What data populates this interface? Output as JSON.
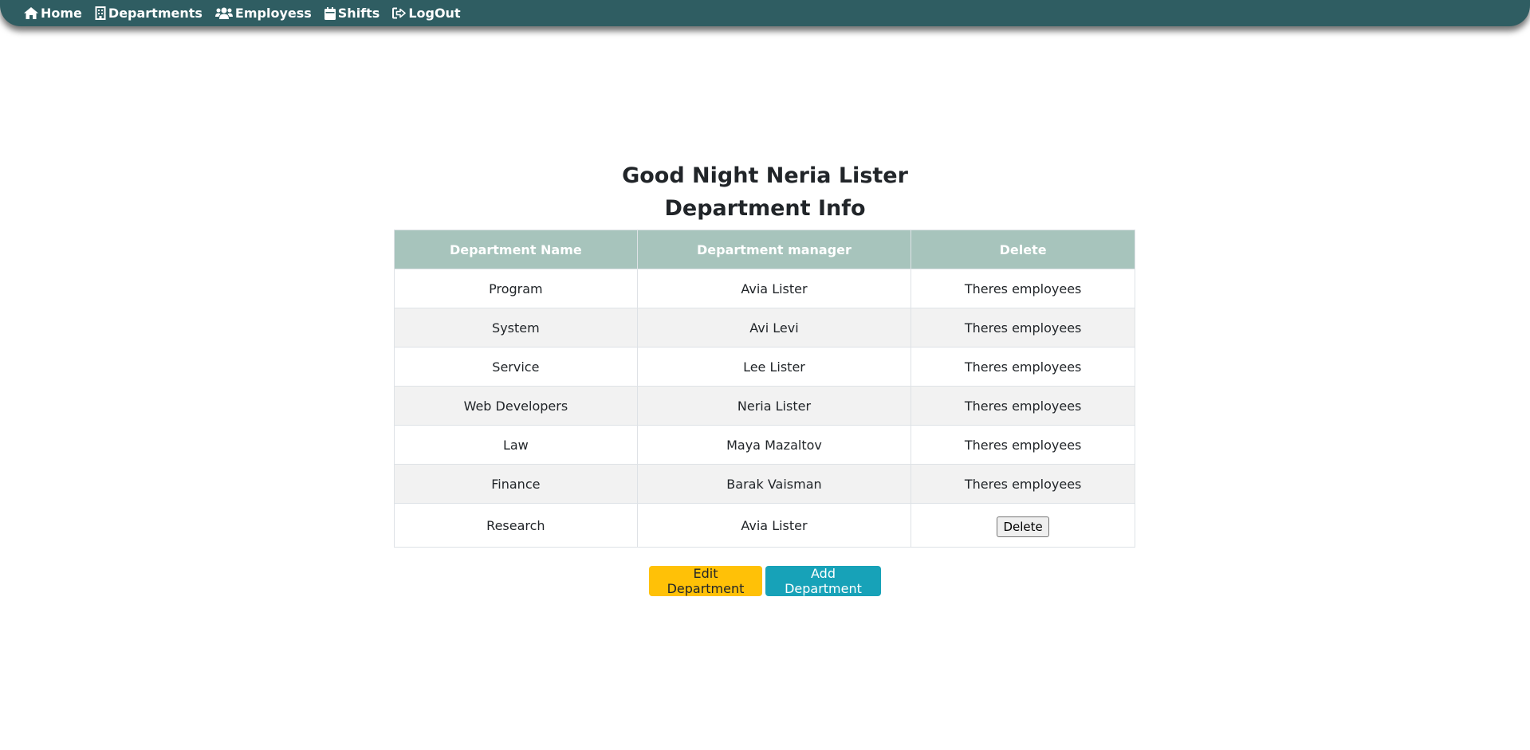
{
  "nav": {
    "home": "Home",
    "departments": "Departments",
    "employees": "Employess",
    "shifts": "Shifts",
    "logout": "LogOut"
  },
  "greeting": "Good Night Neria Lister",
  "subtitle": "Department Info",
  "table": {
    "headers": [
      "Department Name",
      "Department manager",
      "Delete"
    ],
    "rows": [
      {
        "name": "Program",
        "manager": "Avia Lister",
        "delete": "Theres employees"
      },
      {
        "name": "System",
        "manager": "Avi Levi",
        "delete": "Theres employees"
      },
      {
        "name": "Service",
        "manager": "Lee Lister",
        "delete": "Theres employees"
      },
      {
        "name": "Web Developers",
        "manager": "Neria Lister",
        "delete": "Theres employees"
      },
      {
        "name": "Law",
        "manager": "Maya Mazaltov",
        "delete": "Theres employees"
      },
      {
        "name": "Finance",
        "manager": "Barak Vaisman",
        "delete": "Theres employees"
      },
      {
        "name": "Research",
        "manager": "Avia Lister",
        "delete_button": "Delete"
      }
    ]
  },
  "buttons": {
    "edit": "Edit Department",
    "add": "Add Department"
  },
  "colors": {
    "navbar": "#2f5d62",
    "table_header": "#a7c4bc",
    "edit_button": "#ffc107",
    "add_button": "#17a2b8"
  },
  "icons": {
    "home": "home-icon",
    "departments": "building-icon",
    "employees": "users-icon",
    "shifts": "calendar-icon",
    "logout": "logout-icon"
  }
}
